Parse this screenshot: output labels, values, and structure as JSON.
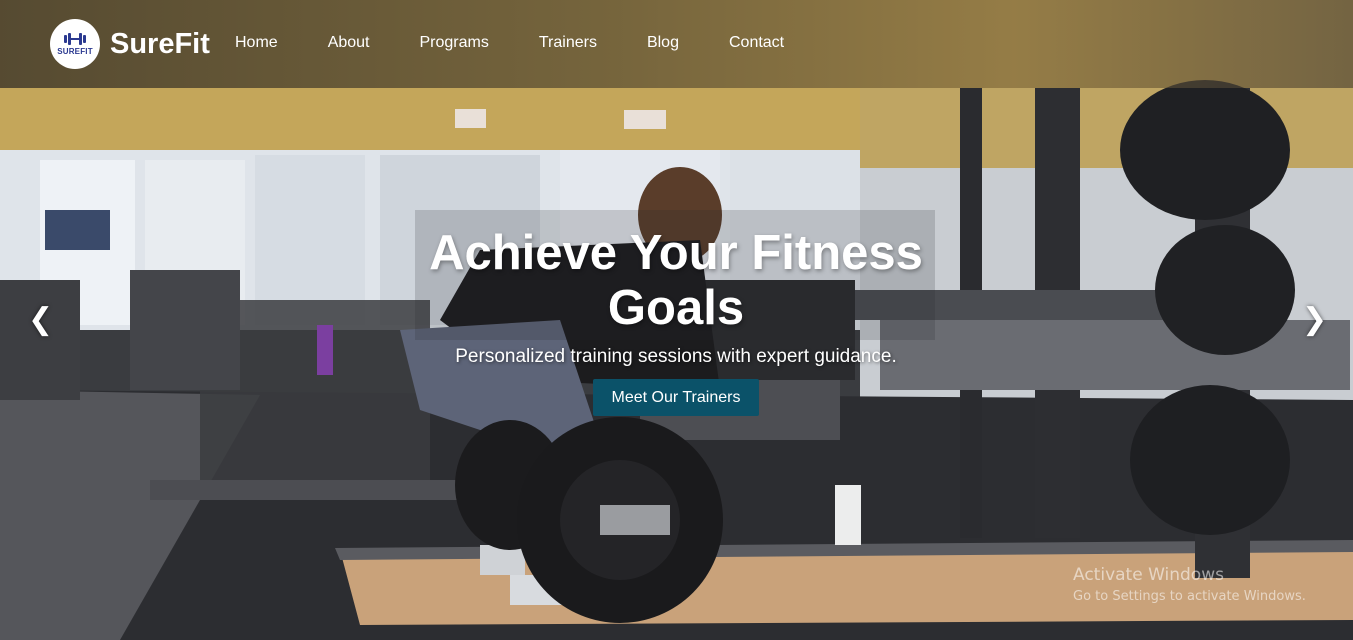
{
  "brand": {
    "name": "SureFit",
    "logo_text": "SUREFIT",
    "logo_icon": "dumbbell-icon",
    "logo_color": "#2b3990"
  },
  "nav": {
    "items": [
      {
        "label": "Home"
      },
      {
        "label": "About"
      },
      {
        "label": "Programs"
      },
      {
        "label": "Trainers"
      },
      {
        "label": "Blog"
      },
      {
        "label": "Contact"
      }
    ]
  },
  "hero": {
    "title": "Achieve Your Fitness Goals",
    "subtitle": "Personalized training sessions with expert guidance.",
    "cta_label": "Meet Our Trainers",
    "cta_color": "#0b5269"
  },
  "carousel": {
    "prev_glyph": "❮",
    "next_glyph": "❯"
  },
  "watermark": {
    "title": "Activate Windows",
    "subtitle": "Go to Settings to activate Windows."
  }
}
